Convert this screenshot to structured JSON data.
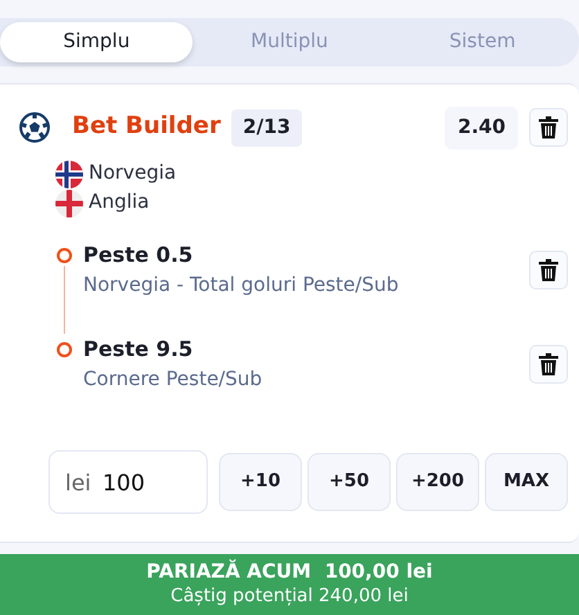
{
  "tabs": [
    {
      "label": "Simplu",
      "selected": true
    },
    {
      "label": "Multiplu",
      "selected": false
    },
    {
      "label": "Sistem",
      "selected": false
    }
  ],
  "bet": {
    "title": "Bet Builder",
    "count": "2/13",
    "odds": "2.40",
    "teams": [
      {
        "name": "Norvegia",
        "kind": "nordic-cross"
      },
      {
        "name": "Anglia",
        "kind": "cross"
      }
    ],
    "selections": [
      {
        "pick": "Peste 0.5",
        "market": "Norvegia - Total goluri Peste/Sub"
      },
      {
        "pick": "Peste 9.5",
        "market": "Cornere Peste/Sub"
      }
    ]
  },
  "stake": {
    "prefix": "lei",
    "value": "100",
    "quick": [
      "+10",
      "+50",
      "+200",
      "MAX"
    ]
  },
  "submit": {
    "label": "PARIAZĂ ACUM  100,00 lei",
    "potential": "Câștig potențial 240,00 lei"
  }
}
